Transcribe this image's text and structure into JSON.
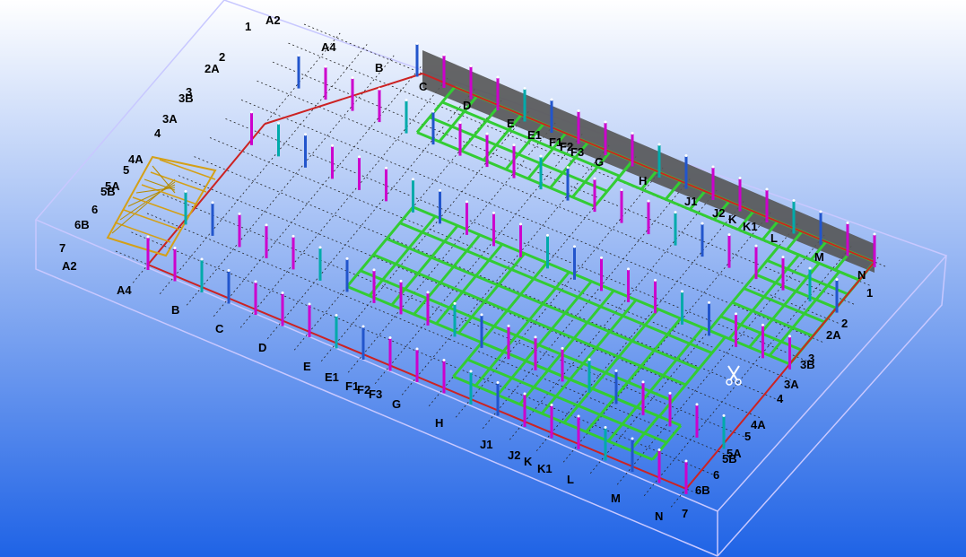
{
  "viewport": {
    "background_top": "#ffffff",
    "background_bottom": "#1f63e6"
  },
  "grid_labels": {
    "left_axis_far": [
      "1",
      "A2",
      "2",
      "2A",
      "3",
      "3B",
      "3A",
      "4",
      "4A",
      "5",
      "5A",
      "5B",
      "6",
      "6B",
      "7",
      "A2"
    ],
    "top_axis": [
      "A4",
      "B",
      "C",
      "D",
      "E",
      "E1",
      "F1",
      "F2",
      "F3",
      "G",
      "H",
      "J1",
      "J2",
      "K",
      "K1",
      "L",
      "M",
      "N",
      "1"
    ],
    "front_axis": [
      "A4",
      "B",
      "C",
      "D",
      "E",
      "E1",
      "F1",
      "F2",
      "F3",
      "G",
      "H",
      "J1",
      "J2",
      "K",
      "K1",
      "L",
      "M",
      "N",
      "7"
    ],
    "right_axis": [
      "2",
      "2A",
      "3",
      "3B",
      "3A",
      "4",
      "4A",
      "5",
      "5A",
      "5B",
      "6",
      "6B"
    ]
  },
  "colors": {
    "beam_green": "#33cc33",
    "column_magenta": "#cc00cc",
    "column_blue": "#2255cc",
    "column_teal": "#00aaaa",
    "edge_red": "#cc2222",
    "bracing_yellow": "#d4a017",
    "wall_gray": "#555555",
    "grid_dashed": "#222222",
    "bounding_box": "#c8c8ff"
  },
  "icons": {
    "cut_tool": "scissors-icon"
  }
}
